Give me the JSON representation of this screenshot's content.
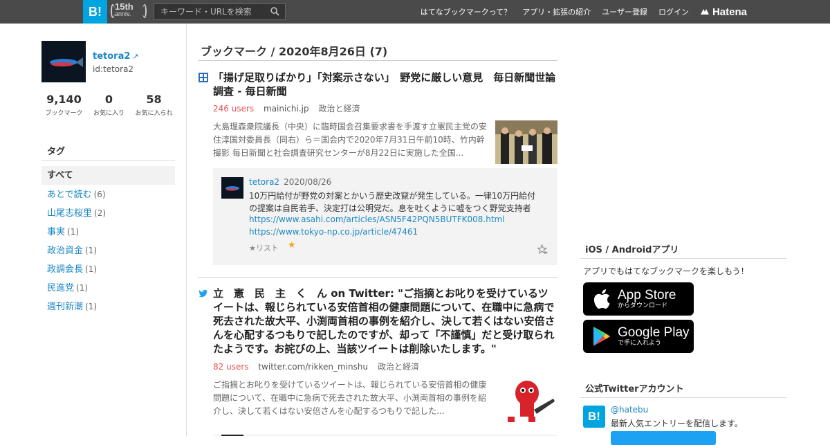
{
  "header": {
    "logo": "B!",
    "anniv_number": "15th",
    "anniv_text": "anniv.",
    "search_placeholder": "キーワード・URLを検索",
    "nav": [
      "はてなブックマークって？",
      "アプリ・拡張の紹介",
      "ユーザー登録",
      "ログイン"
    ],
    "brand": "Hatena"
  },
  "profile": {
    "name": "tetora2",
    "id": "id:tetora2",
    "stats": [
      {
        "value": "9,140",
        "label": "ブックマーク"
      },
      {
        "value": "0",
        "label": "お気に入り"
      },
      {
        "value": "58",
        "label": "お気に入られ"
      }
    ]
  },
  "tags": {
    "heading": "タグ",
    "all": "すべて",
    "items": [
      {
        "name": "あとで読む",
        "count": "(6)"
      },
      {
        "name": "山尾志桜里",
        "count": "(2)"
      },
      {
        "name": "事実",
        "count": "(1)"
      },
      {
        "name": "政治資金",
        "count": "(1)"
      },
      {
        "name": "政調会長",
        "count": "(1)"
      },
      {
        "name": "民進党",
        "count": "(1)"
      },
      {
        "name": "週刊新潮",
        "count": "(1)"
      }
    ]
  },
  "main": {
    "heading": "ブックマーク / 2020年8月26日 (7)",
    "entries": [
      {
        "title": "「揚げ足取りばかり」「対案示さない」　野党に厳しい意見　毎日新聞世論調査 - 毎日新聞",
        "users": "246 users",
        "domain": "mainichi.jp",
        "category": "政治と経済",
        "summary": "大島理森衆院議長（中央）に臨時国会召集要求書を手渡す立憲民主党の安住淳国対委員長（同右）ら＝国会内で2020年7月31日午前10時、竹内幹撮影 毎日新聞と社会調査研究センターが8月22日に実施した全国...",
        "comment": {
          "user": "tetora2",
          "date": "2020/08/26",
          "text": "10万円給付が野党の対案とかいう歴史改竄が発生している。一律10万円給付の提案は自民若手、決定打は公明党だ。息を吐くように嘘をつく野党支持者",
          "links": [
            "https://www.asahi.com/articles/ASN5F42PQN5BUTFK008.html",
            "https://www.tokyo-np.co.jp/article/47461"
          ],
          "list_label": "★リスト",
          "star": "★"
        }
      },
      {
        "title": "立　憲　民　主　く　ん on Twitter: \"ご指摘とお叱りを受けているツイートは、報じられている安倍首相の健康問題について、在職中に急病で死去された故大平、小渕両首相の事例を紹介し、決して若くはない安倍さんを心配するつもりで記したのですが、却って「不謹慎」だと受け取られたようです。お詫びの上、当該ツイートは削除いたします。\"",
        "users": "82 users",
        "domain": "twitter.com/rikken_minshu",
        "category": "政治と経済",
        "summary": "ご指摘とお叱りを受けているツイートは、報じられている安倍首相の健康問題について、在職中に急病で死去された故大平、小渕両首相の事例を紹介し、決して若くはない安倍さんを心配するつもりで記した..."
      }
    ]
  },
  "sidebar": {
    "app_heading": "iOS / Androidアプリ",
    "app_text": "アプリでもはてなブックマークを楽しもう！",
    "appstore_big": "App Store",
    "appstore_small": "からダウンロード",
    "googleplay_big": "Google Play",
    "googleplay_small": "で手に入れよう",
    "twitter_heading": "公式Twitterアカウント",
    "twitter_logo": "B!",
    "twitter_name": "@hatebu",
    "twitter_desc": "最新人気エントリーを配信します。"
  },
  "colors": {
    "topbar": "#4a4a4a",
    "brand_blue": "#00a4de",
    "link": "#1a87c4",
    "users_red": "#e05454",
    "star": "#f5a623"
  }
}
